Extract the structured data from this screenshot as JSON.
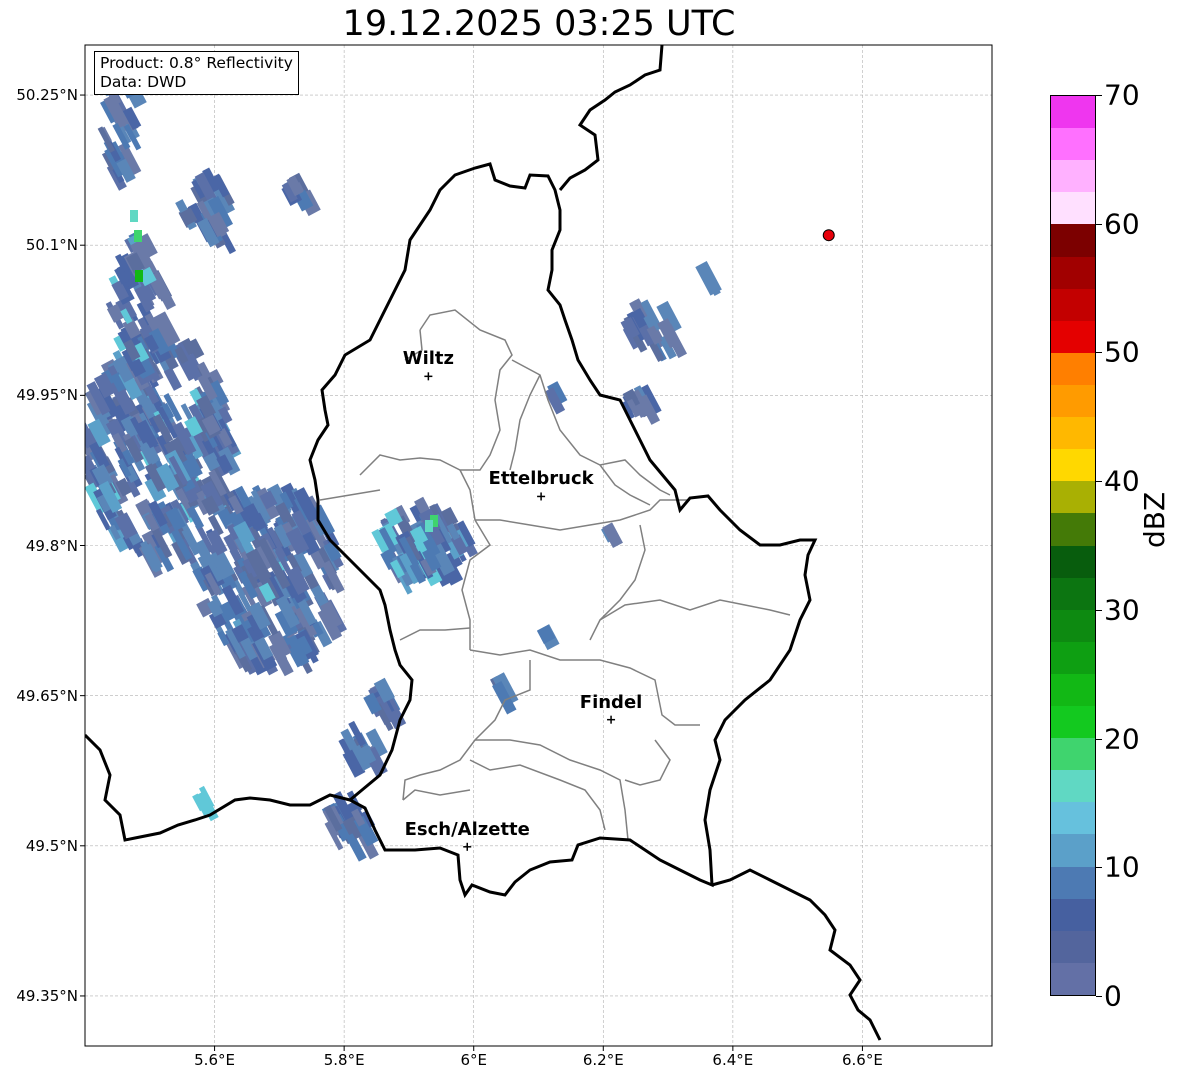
{
  "title": "19.12.2025 03:25 UTC",
  "infobox": {
    "line1": "Product: 0.8° Reflectivity",
    "line2": "Data: DWD"
  },
  "map": {
    "lon_range": [
      5.4,
      6.8
    ],
    "lat_range": [
      49.3,
      50.3
    ],
    "lat_ticks": [
      {
        "value": 50.25,
        "label": "50.25°N"
      },
      {
        "value": 50.1,
        "label": "50.1°N"
      },
      {
        "value": 49.95,
        "label": "49.95°N"
      },
      {
        "value": 49.8,
        "label": "49.8°N"
      },
      {
        "value": 49.65,
        "label": "49.65°N"
      },
      {
        "value": 49.5,
        "label": "49.5°N"
      },
      {
        "value": 49.35,
        "label": "49.35°N"
      }
    ],
    "lon_ticks": [
      {
        "value": 5.6,
        "label": "5.6°E"
      },
      {
        "value": 5.8,
        "label": "5.8°E"
      },
      {
        "value": 6.0,
        "label": "6°E"
      },
      {
        "value": 6.2,
        "label": "6.2°E"
      },
      {
        "value": 6.4,
        "label": "6.4°E"
      },
      {
        "value": 6.6,
        "label": "6.6°E"
      }
    ],
    "cities": [
      {
        "name": "Wiltz",
        "lon": 5.93,
        "lat": 49.969
      },
      {
        "name": "Ettelbruck",
        "lon": 6.104,
        "lat": 49.849
      },
      {
        "name": "Findel",
        "lon": 6.212,
        "lat": 49.626
      },
      {
        "name": "Esch/Alzette",
        "lon": 5.99,
        "lat": 49.499
      }
    ],
    "radar_site": {
      "lon": 6.548,
      "lat": 50.11,
      "color": "#e8000b"
    },
    "colors": {
      "country_border": "#000000",
      "canton_border": "#808080",
      "grid": "#b0b0b0",
      "echo_main": "#5b70a8"
    }
  },
  "colorbar": {
    "label": "dBZ",
    "min": 0,
    "max": 70,
    "ticks": [
      {
        "value": 0,
        "label": "0"
      },
      {
        "value": 10,
        "label": "10"
      },
      {
        "value": 20,
        "label": "20"
      },
      {
        "value": 30,
        "label": "30"
      },
      {
        "value": 40,
        "label": "40"
      },
      {
        "value": 50,
        "label": "50"
      },
      {
        "value": 60,
        "label": "60"
      },
      {
        "value": 70,
        "label": "70"
      }
    ],
    "colors": [
      "#6370a6",
      "#53659d",
      "#4660a0",
      "#4d7ab3",
      "#5ba0c9",
      "#66c1dd",
      "#60d8c3",
      "#3fd46e",
      "#13c91f",
      "#12b815",
      "#0e9f12",
      "#0d8a11",
      "#0c7511",
      "#085d0d",
      "#447a07",
      "#a9b003",
      "#ffd800",
      "#ffb800",
      "#ff9b00",
      "#ff7f00",
      "#e40000",
      "#c30000",
      "#a10000",
      "#7c0000",
      "#ffe0ff",
      "#ffb1ff",
      "#ff70ff",
      "#ef36ef"
    ]
  }
}
